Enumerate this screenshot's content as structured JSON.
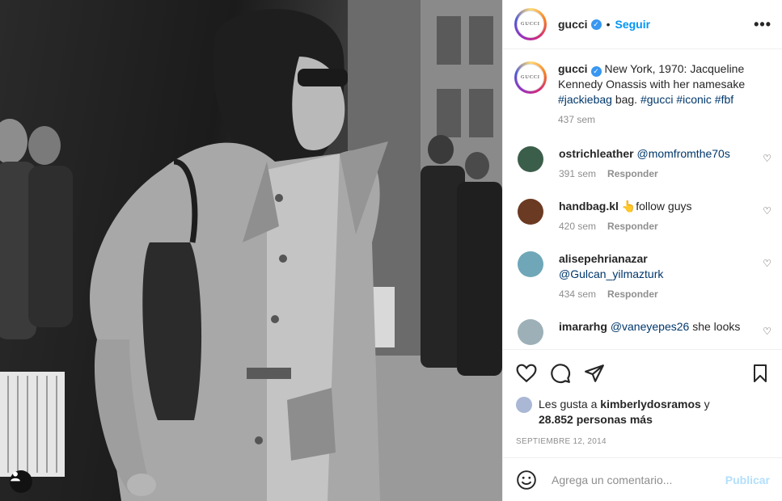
{
  "post": {
    "author": "gucci",
    "follow_label": "Seguir",
    "separator": "•",
    "more_label": "•••",
    "avatar_text": "GUCCI"
  },
  "caption": {
    "author": "gucci",
    "text": "New York, 1970: Jacqueline Kennedy Onassis with her namesake",
    "hashtags": "#jackiebag",
    "text2": " bag. ",
    "hashtags2": "#gucci #iconic #fbf",
    "time": "437 sem"
  },
  "comments": [
    {
      "user": "ostrichleather",
      "mention": "@momfromthe70s",
      "text": "",
      "time": "391 sem",
      "reply": "Responder",
      "avatar_color": "#3b5e4a"
    },
    {
      "user": "handbag.kl",
      "mention": "",
      "text": "👆follow guys",
      "time": "420 sem",
      "reply": "Responder",
      "avatar_color": "#6b3a22"
    },
    {
      "user": "alisepehrianazar",
      "mention": "@Gulcan_yilmazturk",
      "text": "",
      "time": "434 sem",
      "reply": "Responder",
      "avatar_color": "#6fa7b8"
    },
    {
      "user": "imararhg",
      "mention": "@vaneyepes26",
      "text": " she looks",
      "time": "",
      "reply": "",
      "avatar_color": "#9db0b8"
    }
  ],
  "likes": {
    "prefix": "Les gusta a ",
    "user": "kimberlydosramos",
    "middle": " y",
    "count": "28.852 personas más"
  },
  "date": "Septiembre 12, 2014",
  "composer": {
    "placeholder": "Agrega un comentario...",
    "publish_label": "Publicar"
  },
  "icons": {
    "like": "heart-icon",
    "comment": "comment-icon",
    "share": "share-icon",
    "save": "bookmark-icon",
    "emoji": "emoji-icon",
    "tag": "user-tag-icon"
  },
  "colors": {
    "accent": "#0095f6",
    "link": "#00376b",
    "muted": "#8e8e8e"
  }
}
